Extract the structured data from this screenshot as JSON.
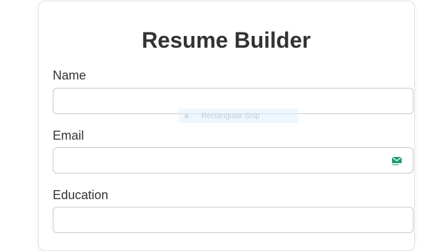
{
  "form": {
    "title": "Resume Builder",
    "fields": [
      {
        "label": "Name",
        "value": "",
        "placeholder": ""
      },
      {
        "label": "Email",
        "value": "",
        "placeholder": ""
      },
      {
        "label": "Education",
        "value": "",
        "placeholder": ""
      }
    ]
  },
  "overlay": {
    "snip_label": "Rectangular Snip"
  },
  "icons": {
    "email_field_icon": "mail-icon"
  },
  "colors": {
    "title_text": "#333333",
    "input_border": "#c8c8c8",
    "mail_icon_accent": "#1e9b7a"
  }
}
